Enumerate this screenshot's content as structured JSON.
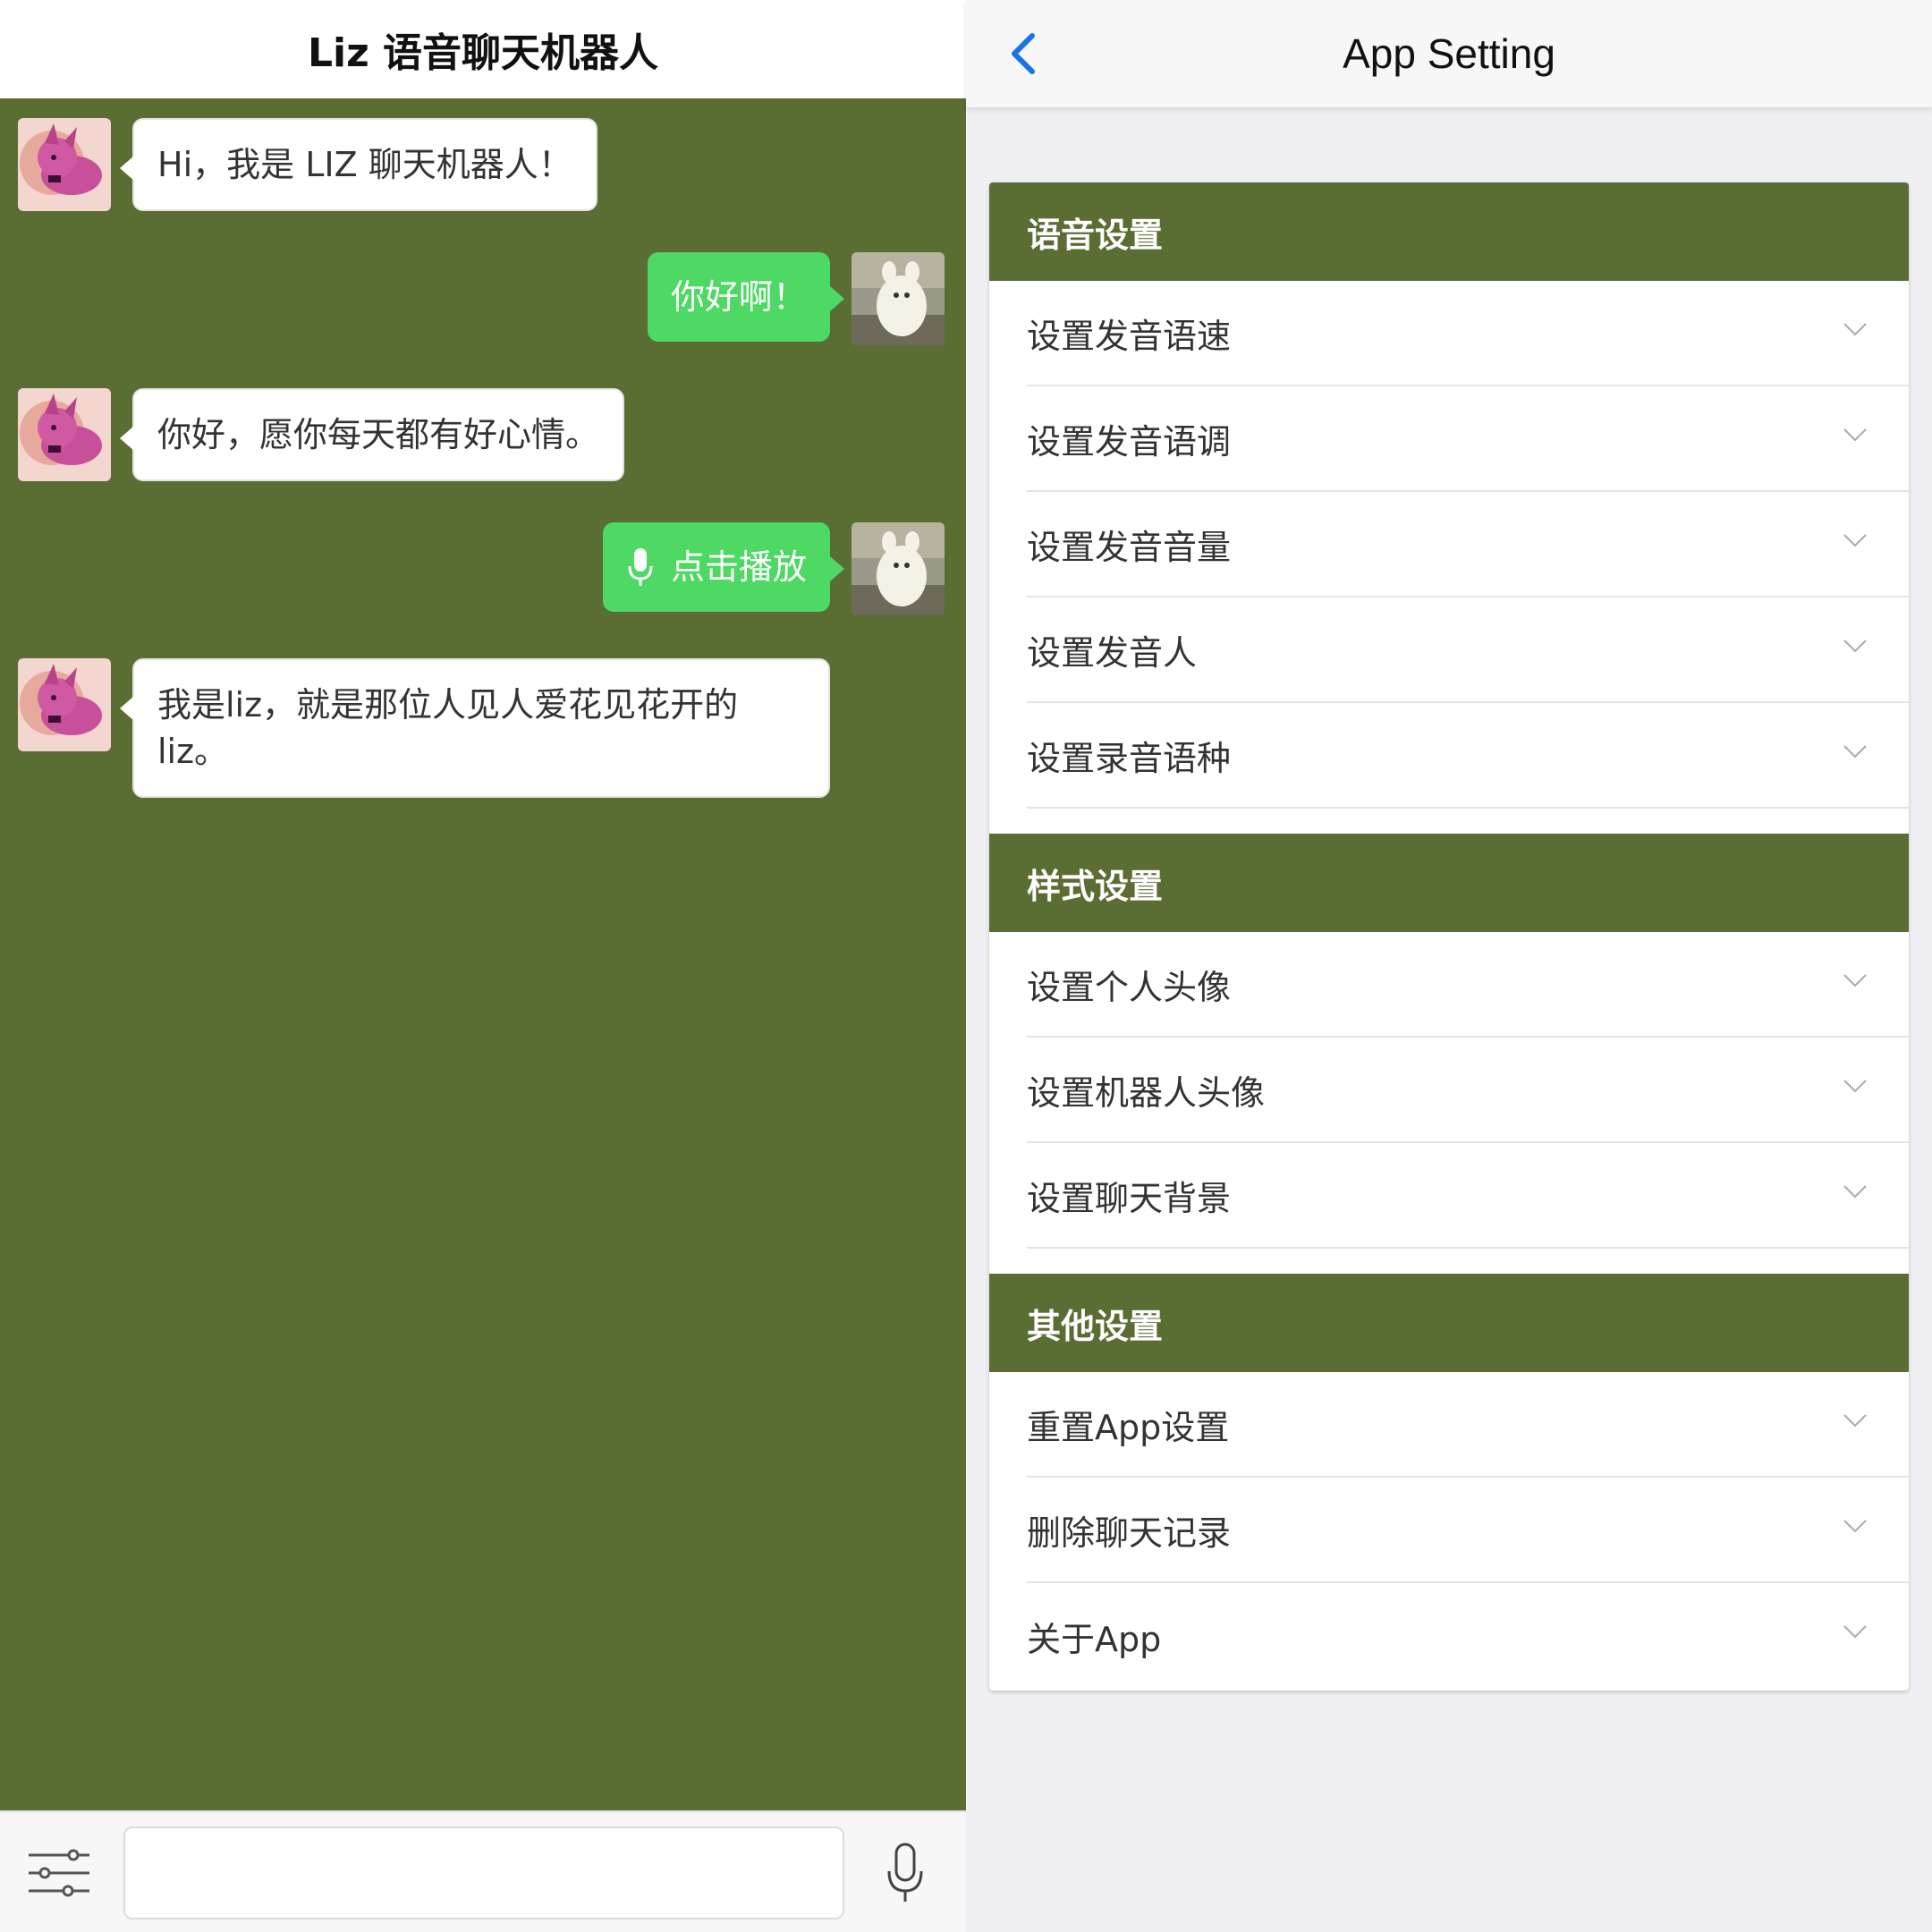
{
  "chat": {
    "title": "Liz 语音聊天机器人",
    "messages": [
      {
        "from": "bot",
        "text": "Hi，我是 LIZ 聊天机器人！"
      },
      {
        "from": "user",
        "text": "你好啊！"
      },
      {
        "from": "bot",
        "text": "你好，愿你每天都有好心情。"
      },
      {
        "from": "user",
        "type": "voice",
        "text": "点击播放",
        "icon": "microphone-icon"
      },
      {
        "from": "bot",
        "text": "我是liz，就是那位人见人爱花见花开的liz。"
      }
    ],
    "input": {
      "value": "",
      "placeholder": ""
    },
    "footer_icons": {
      "settings": "sliders-icon",
      "voice": "microphone-icon"
    }
  },
  "settings": {
    "title": "App Setting",
    "back_icon": "chevron-left-icon",
    "sections": [
      {
        "title": "语音设置",
        "items": [
          "设置发音语速",
          "设置发音语调",
          "设置发音音量",
          "设置发音人",
          "设置录音语种"
        ]
      },
      {
        "title": "样式设置",
        "items": [
          "设置个人头像",
          "设置机器人头像",
          "设置聊天背景"
        ]
      },
      {
        "title": "其他设置",
        "items": [
          "重置App设置",
          "删除聊天记录",
          "关于App"
        ]
      }
    ]
  },
  "colors": {
    "chat_background": "#5a6d33",
    "section_header": "#5a6d33",
    "user_bubble": "#4dd964",
    "accent_blue": "#1a73e8"
  }
}
